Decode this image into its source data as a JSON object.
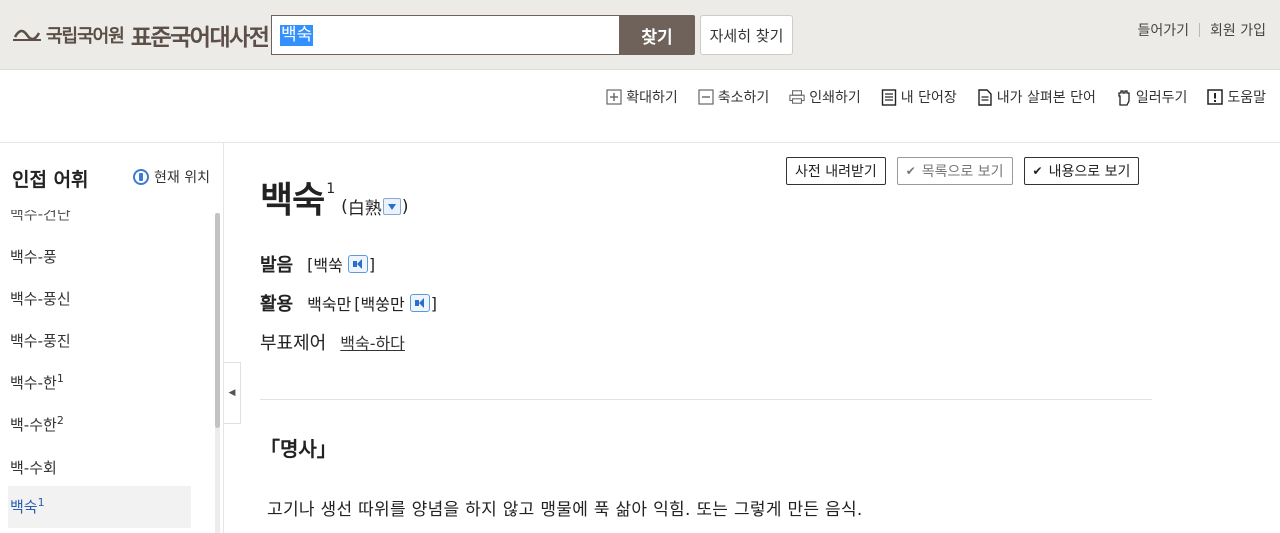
{
  "header": {
    "org_name": "국립국어원",
    "dict_name": "표준국어대사전",
    "search_value": "백숙",
    "search_button": "찾기",
    "detail_search": "자세히 찾기",
    "login": "들어가기",
    "signup": "회원 가입"
  },
  "toolbar": {
    "items": [
      {
        "label": "확대하기",
        "icon": "zoom-in-icon"
      },
      {
        "label": "축소하기",
        "icon": "zoom-out-icon"
      },
      {
        "label": "인쇄하기",
        "icon": "print-icon"
      },
      {
        "label": "내 단어장",
        "icon": "vocabulary-icon"
      },
      {
        "label": "내가 살펴본 단어",
        "icon": "history-icon"
      },
      {
        "label": "일러두기",
        "icon": "hand-icon"
      },
      {
        "label": "도움말",
        "icon": "help-icon"
      }
    ]
  },
  "sidebar": {
    "title": "인접 어휘",
    "current_location": "현재 위치",
    "items": [
      {
        "label": "백수-건단"
      },
      {
        "label": "백수-풍"
      },
      {
        "label": "백수-풍신"
      },
      {
        "label": "백수-풍진"
      },
      {
        "label": "백수-한",
        "sup": "1"
      },
      {
        "label": "백-수한",
        "sup": "2"
      },
      {
        "label": "백-수회"
      },
      {
        "label": "백숙",
        "sup": "1"
      }
    ]
  },
  "entry": {
    "download_btn": "사전 내려받기",
    "list_view_btn": "목록으로 보기",
    "content_view_btn": "내용으로 보기",
    "headword": "백숙",
    "headword_sup": "1",
    "hanja_open": "(",
    "hanja": "白熟",
    "hanja_close": ")",
    "pron_label": "발음",
    "pron_open": "[",
    "pron_value": "백쑥",
    "pron_close": "]",
    "conj_label": "활용",
    "conj_form": "백숙만",
    "conj_pron_open": "[",
    "conj_pron": "백쑹만",
    "conj_pron_close": "]",
    "deriv_label": "부표제어",
    "deriv_value": "백숙-하다",
    "pos": "「명사」",
    "definition": "고기나 생선 따위를 양념을 하지 않고 맹물에 푹 삶아 익힘. 또는 그렇게 만든 음식."
  },
  "colors": {
    "header_bg": "#ecebe7",
    "brand": "#6f625a",
    "highlight": "#3390ff",
    "accent_blue": "#2a6fc9"
  }
}
